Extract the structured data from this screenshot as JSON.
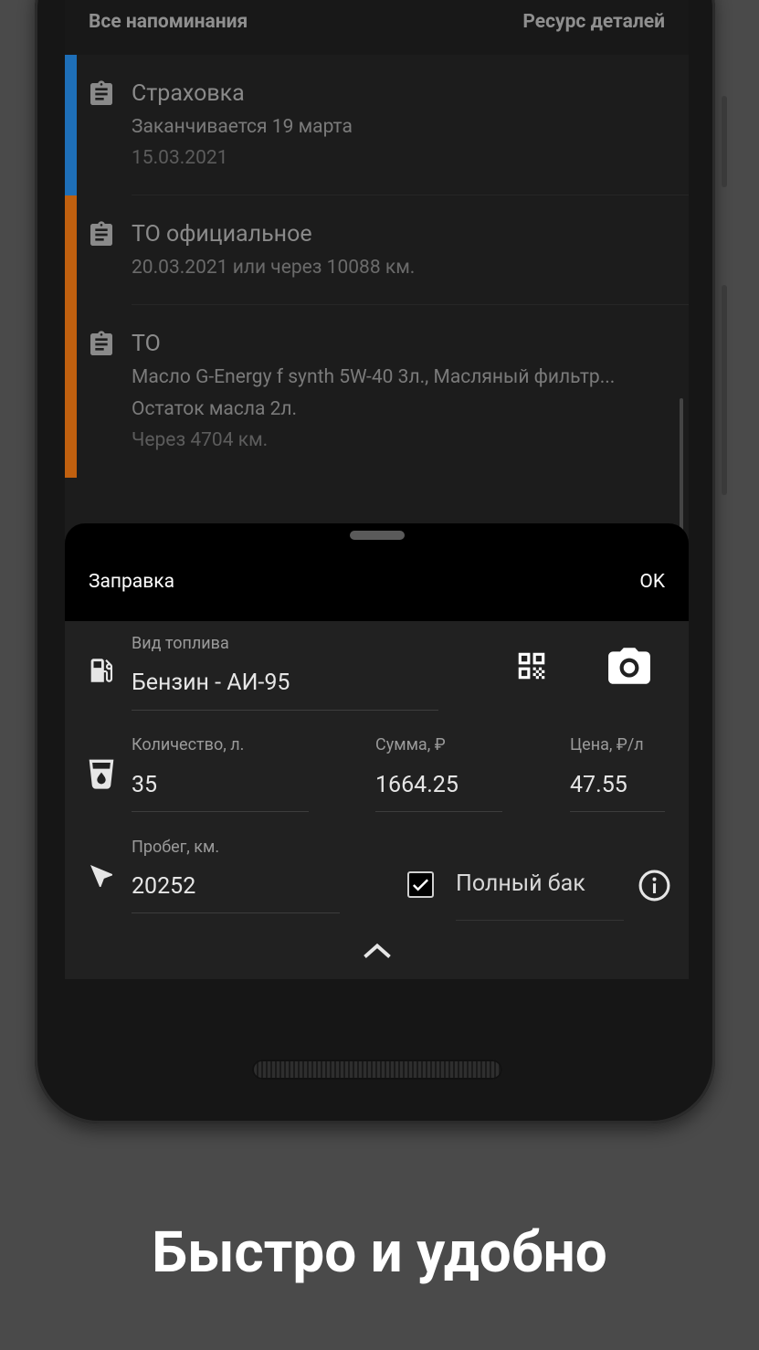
{
  "list": {
    "header_left": "Все напоминания",
    "header_right": "Ресурс деталей",
    "items": [
      {
        "title": "Страховка",
        "line1": "Заканчивается 19 марта",
        "line2": "15.03.2021",
        "accent": "#1e6fb8",
        "icon": "clipboard-icon"
      },
      {
        "title": "ТО официальное",
        "line1": "20.03.2021 или через 10088 км.",
        "accent": "#c0600f",
        "icon": "clipboard-icon"
      },
      {
        "title": "ТО",
        "line1": "Масло G-Energy f synth 5W-40 3л., Масляный фильтр...",
        "line2": "Остаток масла 2л.",
        "line3": "Через 4704 км.",
        "accent": "#c0600f",
        "icon": "clipboard-icon"
      }
    ]
  },
  "sheet": {
    "title": "Заправка",
    "ok": "OK",
    "fuel_type_label": "Вид топлива",
    "fuel_type_value": "Бензин - АИ-95",
    "quantity_label": "Количество, л.",
    "quantity_value": "35",
    "sum_label": "Сумма, ₽",
    "sum_value": "1664.25",
    "price_label": "Цена, ₽/л",
    "price_value": "47.55",
    "mileage_label": "Пробег, км.",
    "mileage_value": "20252",
    "full_tank_label": "Полный бак",
    "full_tank_checked": true,
    "icons": [
      "fuel-pump-icon",
      "qr-code-icon",
      "camera-icon",
      "fuel-cup-icon",
      "navigation-icon",
      "checkbox-icon",
      "info-icon",
      "chevron-up-icon"
    ]
  },
  "caption": "Быстро и удобно"
}
